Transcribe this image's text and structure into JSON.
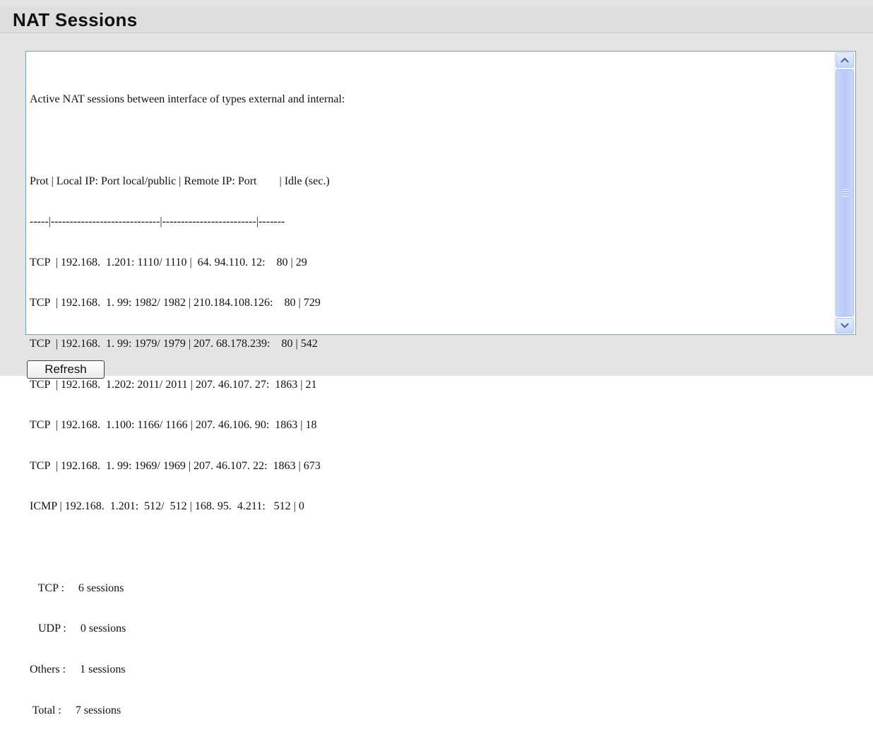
{
  "page": {
    "title": "NAT Sessions"
  },
  "log": {
    "header": "Active NAT sessions between interface of types external and internal:",
    "columns": "Prot | Local IP: Port local/public | Remote IP: Port        | Idle (sec.)",
    "separator": "-----|-----------------------------|-------------------------|-------",
    "rows": [
      "TCP  | 192.168.  1.201: 1110/ 1110 |  64. 94.110. 12:    80 | 29",
      "TCP  | 192.168.  1. 99: 1982/ 1982 | 210.184.108.126:    80 | 729",
      "TCP  | 192.168.  1. 99: 1979/ 1979 | 207. 68.178.239:    80 | 542",
      "TCP  | 192.168.  1.202: 2011/ 2011 | 207. 46.107. 27:  1863 | 21",
      "TCP  | 192.168.  1.100: 1166/ 1166 | 207. 46.106. 90:  1863 | 18",
      "TCP  | 192.168.  1. 99: 1969/ 1969 | 207. 46.107. 22:  1863 | 673",
      "ICMP | 192.168.  1.201:  512/  512 | 168. 95.  4.211:   512 | 0"
    ],
    "summary": [
      "   TCP :     6 sessions",
      "   UDP :     0 sessions",
      "Others :     1 sessions",
      " Total :     7 sessions"
    ]
  },
  "buttons": {
    "refresh": "Refresh"
  }
}
